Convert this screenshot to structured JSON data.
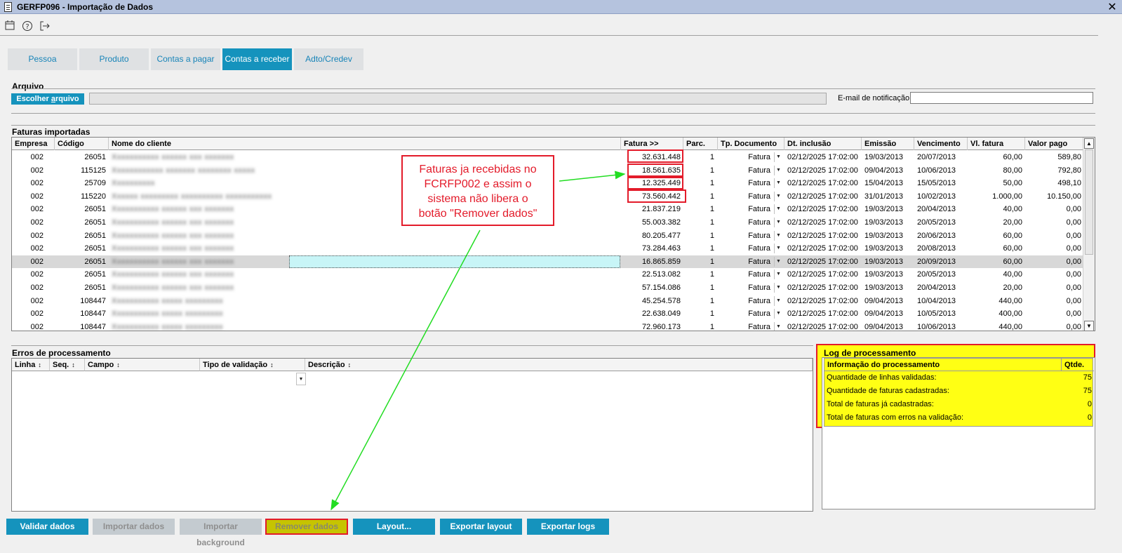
{
  "window": {
    "title": "GERFP096 - Importação de Dados",
    "close": "✕"
  },
  "toolbar": [
    {
      "name": "calendar-icon",
      "glyph": "▭"
    },
    {
      "name": "help-icon",
      "glyph": "?"
    },
    {
      "name": "exit-icon",
      "glyph": "➔"
    }
  ],
  "tabs": [
    {
      "label": "Pessoa",
      "active": false
    },
    {
      "label": "Produto",
      "active": false
    },
    {
      "label": "Contas a pagar",
      "active": false
    },
    {
      "label": "Contas a receber",
      "active": true
    },
    {
      "label": "Adto/Credev",
      "active": false
    }
  ],
  "arquivo": {
    "label": "Arquivo",
    "choose_button_pre": "Escolher ",
    "choose_button_ul": "a",
    "choose_button_post": "rquivo",
    "path_value": "",
    "email_label": "E-mail de notificação",
    "email_value": ""
  },
  "faturas": {
    "label": "Faturas importadas",
    "columns": [
      "Empresa",
      "Código",
      "Nome do cliente",
      "Fatura >>",
      "Parc.",
      "Tp. Documento",
      "Dt. inclusão",
      "Emissão",
      "Vencimento",
      "Vl. fatura",
      "Valor pago"
    ],
    "rows": [
      {
        "empresa": "002",
        "codigo": "26051",
        "cliente": "Xxxxxxxxxxx xxxxxx xxx xxxxxxx",
        "fatura": "32.631.448",
        "parc": "1",
        "tp": "Fatura",
        "inclusao": "02/12/2025 17:02:00",
        "emissao": "19/03/2013",
        "venc": "20/07/2013",
        "vl": "60,00",
        "pago": "589,80"
      },
      {
        "empresa": "002",
        "codigo": "115125",
        "cliente": "Xxxxxxxxxxxx xxxxxxx xxxxxxxx xxxxx",
        "fatura": "18.561.635",
        "parc": "1",
        "tp": "Fatura",
        "inclusao": "02/12/2025 17:02:00",
        "emissao": "09/04/2013",
        "venc": "10/06/2013",
        "vl": "80,00",
        "pago": "792,80"
      },
      {
        "empresa": "002",
        "codigo": "25709",
        "cliente": "Xxxxxxxxxx",
        "fatura": "12.325.449",
        "parc": "1",
        "tp": "Fatura",
        "inclusao": "02/12/2025 17:02:00",
        "emissao": "15/04/2013",
        "venc": "15/05/2013",
        "vl": "50,00",
        "pago": "498,10"
      },
      {
        "empresa": "002",
        "codigo": "115220",
        "cliente": "Xxxxxx xxxxxxxxx xxxxxxxxxx xxxxxxxxxxx",
        "fatura": "73.560.442",
        "parc": "1",
        "tp": "Fatura",
        "inclusao": "02/12/2025 17:02:00",
        "emissao": "31/01/2013",
        "venc": "10/02/2013",
        "vl": "1.000,00",
        "pago": "10.150,00"
      },
      {
        "empresa": "002",
        "codigo": "26051",
        "cliente": "Xxxxxxxxxxx xxxxxx xxx xxxxxxx",
        "fatura": "21.837.219",
        "parc": "1",
        "tp": "Fatura",
        "inclusao": "02/12/2025 17:02:00",
        "emissao": "19/03/2013",
        "venc": "20/04/2013",
        "vl": "40,00",
        "pago": "0,00"
      },
      {
        "empresa": "002",
        "codigo": "26051",
        "cliente": "Xxxxxxxxxxx xxxxxx xxx xxxxxxx",
        "fatura": "55.003.382",
        "parc": "1",
        "tp": "Fatura",
        "inclusao": "02/12/2025 17:02:00",
        "emissao": "19/03/2013",
        "venc": "20/05/2013",
        "vl": "20,00",
        "pago": "0,00"
      },
      {
        "empresa": "002",
        "codigo": "26051",
        "cliente": "Xxxxxxxxxxx xxxxxx xxx xxxxxxx",
        "fatura": "80.205.477",
        "parc": "1",
        "tp": "Fatura",
        "inclusao": "02/12/2025 17:02:00",
        "emissao": "19/03/2013",
        "venc": "20/06/2013",
        "vl": "60,00",
        "pago": "0,00"
      },
      {
        "empresa": "002",
        "codigo": "26051",
        "cliente": "Xxxxxxxxxxx xxxxxx xxx xxxxxxx",
        "fatura": "73.284.463",
        "parc": "1",
        "tp": "Fatura",
        "inclusao": "02/12/2025 17:02:00",
        "emissao": "19/03/2013",
        "venc": "20/08/2013",
        "vl": "60,00",
        "pago": "0,00"
      },
      {
        "empresa": "002",
        "codigo": "26051",
        "cliente": "Xxxxxxxxxxx xxxxxx xxx xxxxxxx",
        "fatura": "16.865.859",
        "parc": "1",
        "tp": "Fatura",
        "inclusao": "02/12/2025 17:02:00",
        "emissao": "19/03/2013",
        "venc": "20/09/2013",
        "vl": "60,00",
        "pago": "0,00",
        "selected": true
      },
      {
        "empresa": "002",
        "codigo": "26051",
        "cliente": "Xxxxxxxxxxx xxxxxx xxx xxxxxxx",
        "fatura": "22.513.082",
        "parc": "1",
        "tp": "Fatura",
        "inclusao": "02/12/2025 17:02:00",
        "emissao": "19/03/2013",
        "venc": "20/05/2013",
        "vl": "40,00",
        "pago": "0,00"
      },
      {
        "empresa": "002",
        "codigo": "26051",
        "cliente": "Xxxxxxxxxxx xxxxxx xxx xxxxxxx",
        "fatura": "57.154.086",
        "parc": "1",
        "tp": "Fatura",
        "inclusao": "02/12/2025 17:02:00",
        "emissao": "19/03/2013",
        "venc": "20/04/2013",
        "vl": "20,00",
        "pago": "0,00"
      },
      {
        "empresa": "002",
        "codigo": "108447",
        "cliente": "Xxxxxxxxxxx xxxxx xxxxxxxxx",
        "fatura": "45.254.578",
        "parc": "1",
        "tp": "Fatura",
        "inclusao": "02/12/2025 17:02:00",
        "emissao": "09/04/2013",
        "venc": "10/04/2013",
        "vl": "440,00",
        "pago": "0,00"
      },
      {
        "empresa": "002",
        "codigo": "108447",
        "cliente": "Xxxxxxxxxxx xxxxx xxxxxxxxx",
        "fatura": "22.638.049",
        "parc": "1",
        "tp": "Fatura",
        "inclusao": "02/12/2025 17:02:00",
        "emissao": "09/04/2013",
        "venc": "10/05/2013",
        "vl": "400,00",
        "pago": "0,00"
      },
      {
        "empresa": "002",
        "codigo": "108447",
        "cliente": "Xxxxxxxxxxx xxxxx xxxxxxxxx",
        "fatura": "72.960.173",
        "parc": "1",
        "tp": "Fatura",
        "inclusao": "02/12/2025 17:02:00",
        "emissao": "09/04/2013",
        "venc": "10/06/2013",
        "vl": "440,00",
        "pago": "0,00"
      }
    ]
  },
  "callout": {
    "text_lines": [
      "Faturas ja recebidas no",
      "FCRFP002 e assim o",
      "sistema não libera o",
      "botão \"Remover dados\""
    ],
    "color": "#e31b2a"
  },
  "erros": {
    "label": "Erros de processamento",
    "columns": [
      "Linha",
      "Seq.",
      "Campo",
      "Tipo de validação",
      "Descrição"
    ],
    "sort_glyph": "↕"
  },
  "log": {
    "label": "Log de processamento",
    "columns": [
      "Informação do processamento",
      "Qtde."
    ],
    "rows": [
      {
        "info": "Quantidade de linhas validadas:",
        "qtde": "75"
      },
      {
        "info": "Quantidade de faturas cadastradas:",
        "qtde": "75"
      },
      {
        "info": "Total de faturas já cadastradas:",
        "qtde": "0"
      },
      {
        "info": "Total de faturas com erros na validação:",
        "qtde": "0"
      }
    ],
    "highlight_color": "#ffff14"
  },
  "buttons": [
    {
      "label": "Validar dados",
      "state": "enabled"
    },
    {
      "label": "Importar dados",
      "state": "disabled"
    },
    {
      "label": "Importar background",
      "state": "disabled"
    },
    {
      "label": "Remover dados",
      "state": "highlighted-disabled"
    },
    {
      "label": "Layout...",
      "state": "enabled"
    },
    {
      "label": "Exportar layout",
      "state": "enabled"
    },
    {
      "label": "Exportar logs",
      "state": "enabled"
    }
  ],
  "colors": {
    "accent": "#1593bd",
    "annotation_red": "#e31b2a",
    "annotation_green": "#22dd22"
  }
}
